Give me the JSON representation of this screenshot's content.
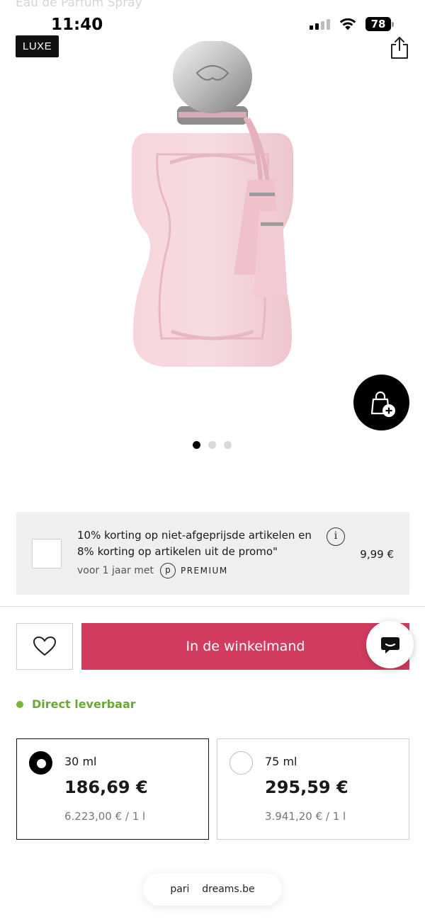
{
  "header": {
    "faded_subtitle": "Eau de Parfum Spray",
    "badge": "LUXE",
    "share_icon": "share-icon"
  },
  "status_bar": {
    "time": "11:40",
    "battery": "78",
    "icons": [
      "signal-icon",
      "wifi-icon",
      "battery-icon"
    ]
  },
  "gallery": {
    "image": "perfume-bottle-pink-image",
    "dots_total": 3,
    "active_dot": 0,
    "bag_icon": "add-to-bag-icon"
  },
  "promo": {
    "text": "10% korting op niet-afgeprijsde artikelen en 8% korting op artikelen uit de promo\"",
    "sub": "voor 1 jaar met",
    "brand_mark": "p",
    "brand_label": "PREMIUM",
    "price": "9,99 €",
    "info": "i"
  },
  "actions": {
    "cart_label": "In de winkelmand",
    "wishlist_icon": "heart-icon",
    "chat_icon": "chat-icon"
  },
  "availability": {
    "label": "Direct leverbaar",
    "color": "#6aa834"
  },
  "sizes": [
    {
      "volume": "30 ml",
      "price": "186,69 €",
      "unit_price": "6.223,00 € / 1 l",
      "selected": true
    },
    {
      "volume": "75 ml",
      "price": "295,59 €",
      "unit_price": "3.941,20 € / 1 l",
      "selected": false
    }
  ],
  "browser": {
    "url": "pari    dreams.be"
  },
  "colors": {
    "accent": "#d23c5f",
    "badge_bg": "#111111",
    "promo_bg": "#efefef",
    "bottle": "#f3cfd6"
  }
}
